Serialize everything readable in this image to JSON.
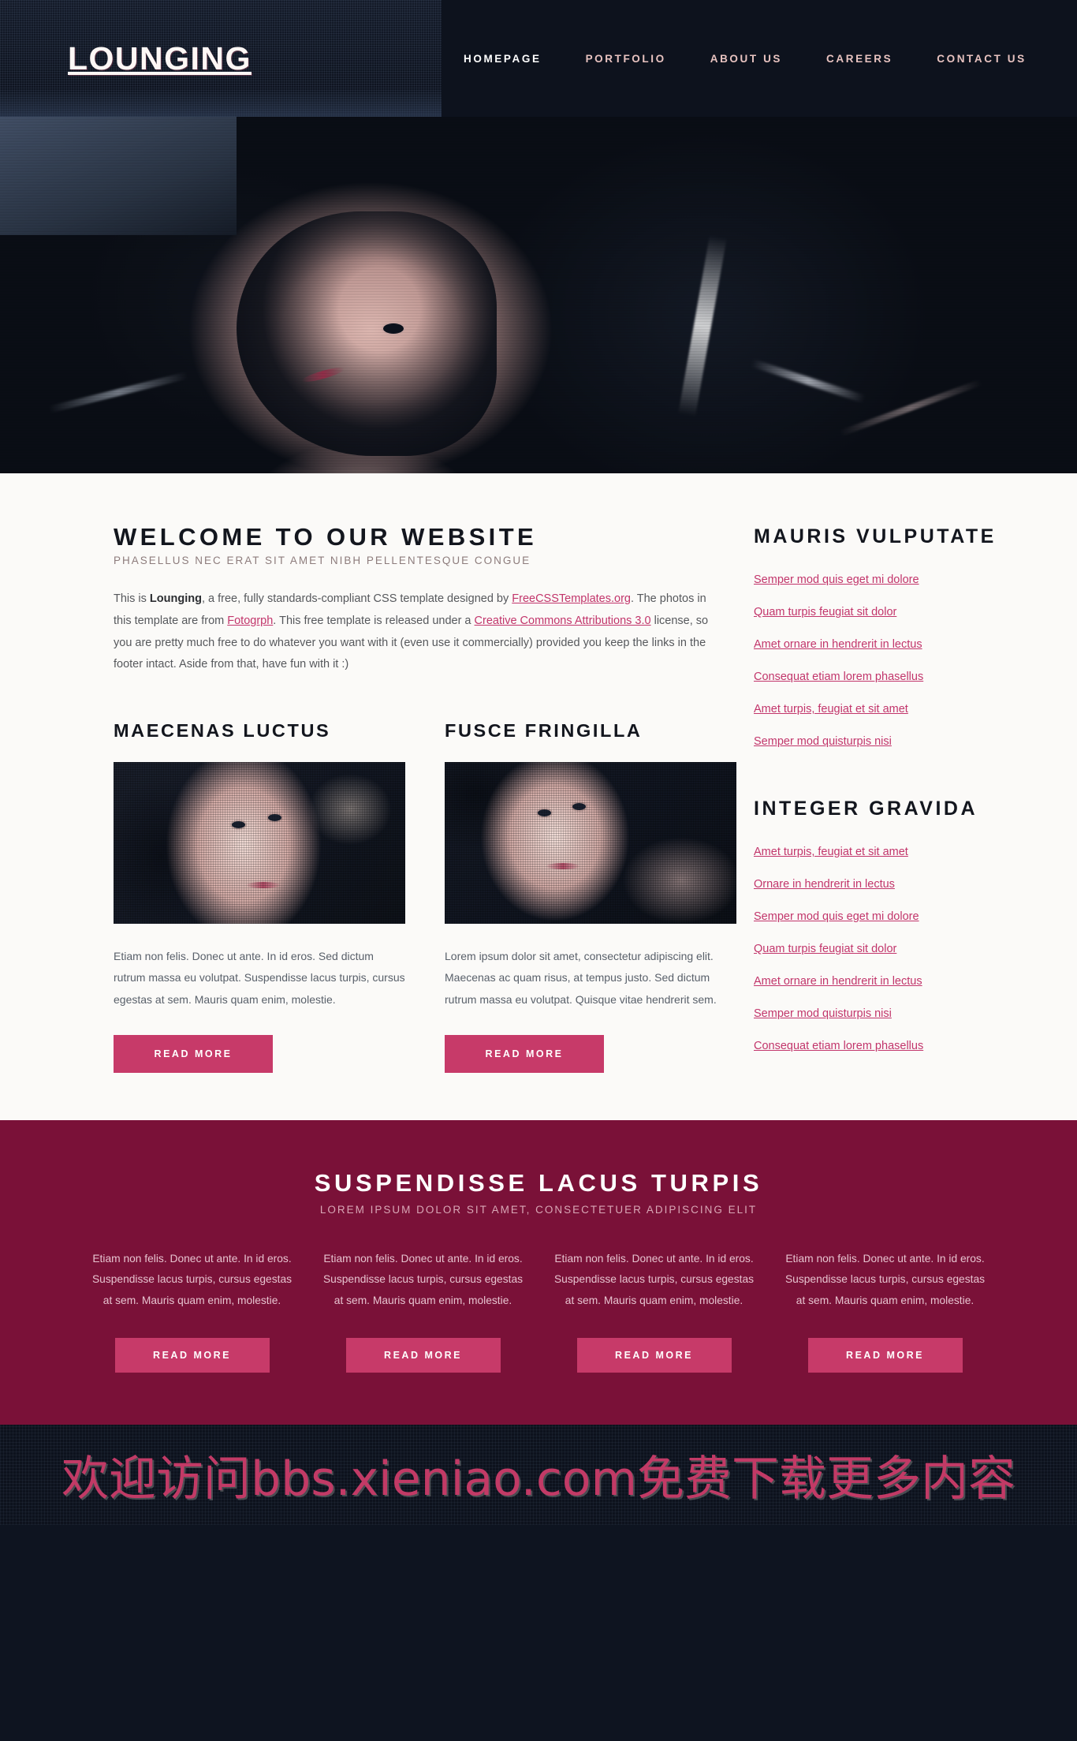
{
  "header": {
    "logo": "LOUNGING",
    "nav": [
      {
        "label": "HOMEPAGE",
        "active": true
      },
      {
        "label": "PORTFOLIO",
        "active": false
      },
      {
        "label": "ABOUT US",
        "active": false
      },
      {
        "label": "CAREERS",
        "active": false
      },
      {
        "label": "CONTACT US",
        "active": false
      }
    ]
  },
  "welcome": {
    "title": "WELCOME TO OUR WEBSITE",
    "subtitle": "PHASELLUS NEC ERAT SIT AMET NIBH PELLENTESQUE CONGUE",
    "intro_1": "This is ",
    "intro_brand": "Lounging",
    "intro_2": ", a free, fully standards-compliant CSS template designed by ",
    "link_freecss": "FreeCSSTemplates.org",
    "intro_3": ". The photos in this template are from ",
    "link_fotogrph": "Fotogrph",
    "intro_4": ". This free template is released under a ",
    "link_cc": "Creative Commons Attributions 3.0",
    "intro_5": " license, so you are pretty much free to do whatever you want with it (even use it commercially) provided you keep the links in the footer intact. Aside from that, have fun with it :)"
  },
  "columns": [
    {
      "heading": "MAECENAS LUCTUS",
      "image_alt": "woman-portrait-photo-1",
      "body": "Etiam non felis. Donec ut ante. In id eros. Sed dictum rutrum massa eu volutpat. Suspendisse lacus turpis, cursus egestas at sem. Mauris quam enim, molestie.",
      "button": "READ MORE"
    },
    {
      "heading": "FUSCE FRINGILLA",
      "image_alt": "woman-portrait-photo-2",
      "body": "Lorem ipsum dolor sit amet, consectetur adipiscing elit. Maecenas ac quam risus, at tempus justo. Sed dictum rutrum massa eu volutpat. Quisque vitae hendrerit sem.",
      "button": "READ MORE"
    }
  ],
  "sidebar": [
    {
      "heading": "MAURIS VULPUTATE",
      "links": [
        "Semper mod quis eget mi dolore",
        "Quam turpis feugiat sit dolor",
        "Amet ornare in hendrerit in lectus",
        "Consequat etiam lorem phasellus",
        "Amet turpis, feugiat et sit amet",
        "Semper mod quisturpis nisi"
      ]
    },
    {
      "heading": "INTEGER GRAVIDA",
      "links": [
        "Amet turpis, feugiat et sit amet",
        "Ornare in hendrerit in lectus",
        "Semper mod quis eget mi dolore",
        "Quam turpis feugiat sit dolor",
        "Amet ornare in hendrerit in lectus",
        "Semper mod quisturpis nisi",
        "Consequat etiam lorem phasellus"
      ]
    }
  ],
  "promo": {
    "title": "SUSPENDISSE LACUS TURPIS",
    "subtitle": "LOREM IPSUM DOLOR SIT AMET, CONSECTETUER ADIPISCING ELIT",
    "cards": [
      {
        "body": "Etiam non felis. Donec ut ante. In id eros. Suspendisse lacus turpis, cursus egestas at sem. Mauris quam enim, molestie.",
        "button": "READ MORE"
      },
      {
        "body": "Etiam non felis. Donec ut ante. In id eros. Suspendisse lacus turpis, cursus egestas at sem. Mauris quam enim, molestie.",
        "button": "READ MORE"
      },
      {
        "body": "Etiam non felis. Donec ut ante. In id eros. Suspendisse lacus turpis, cursus egestas at sem. Mauris quam enim, molestie.",
        "button": "READ MORE"
      },
      {
        "body": "Etiam non felis. Donec ut ante. In id eros. Suspendisse lacus turpis, cursus egestas at sem. Mauris quam enim, molestie.",
        "button": "READ MORE"
      }
    ]
  },
  "watermark": {
    "text": "欢迎访问bbs.xieniao.com免费下载更多内容"
  },
  "colors": {
    "accent_pink": "#c73a69",
    "link_pink": "#c2356b",
    "maroon": "#7a1138",
    "dark_navy": "#0d121d",
    "page_bg": "#fbfaf8",
    "heading_dark": "#13161e",
    "nav_link": "#e8c3c0"
  }
}
